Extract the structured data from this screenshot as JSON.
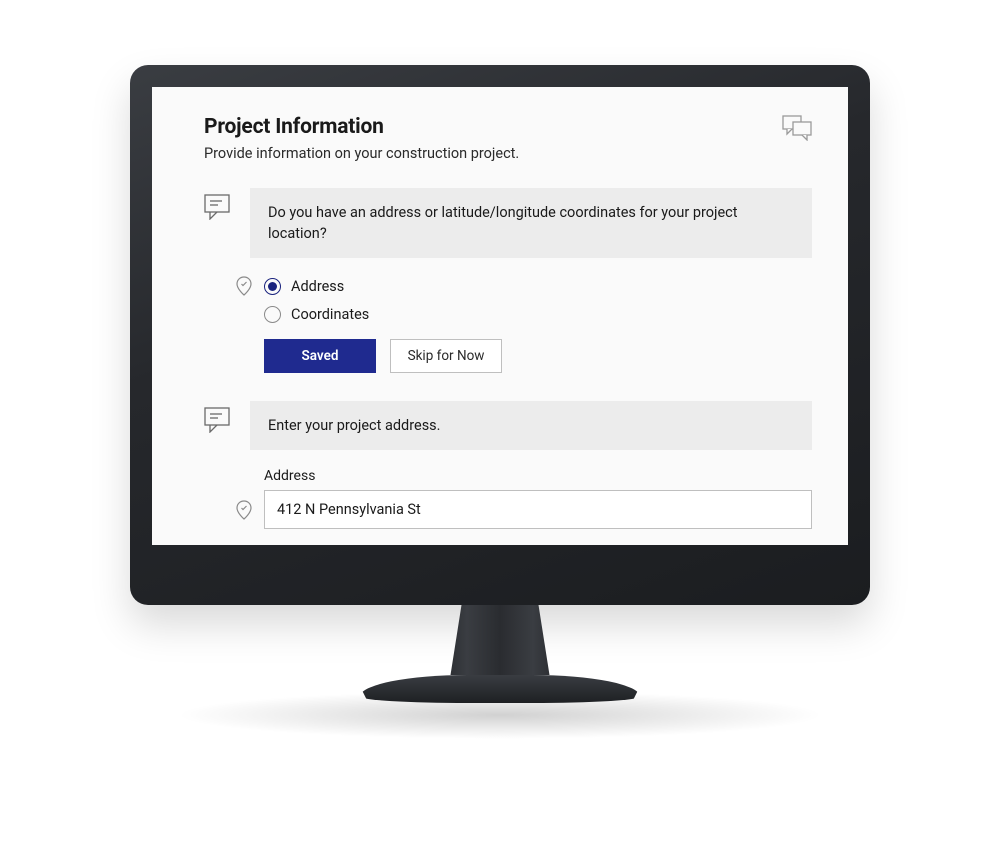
{
  "header": {
    "title": "Project Information",
    "subtitle": "Provide information on your construction project."
  },
  "question1": {
    "prompt": "Do you have an address or latitude/longitude coordinates for your project location?",
    "options": {
      "address": "Address",
      "coordinates": "Coordinates"
    },
    "buttons": {
      "saved": "Saved",
      "skip": "Skip for Now"
    }
  },
  "question2": {
    "prompt": "Enter your project address.",
    "address_label": "Address",
    "address_value": "412 N Pennsylvania St"
  },
  "colors": {
    "primary": "#1f2a8f",
    "panel": "#ececec"
  }
}
